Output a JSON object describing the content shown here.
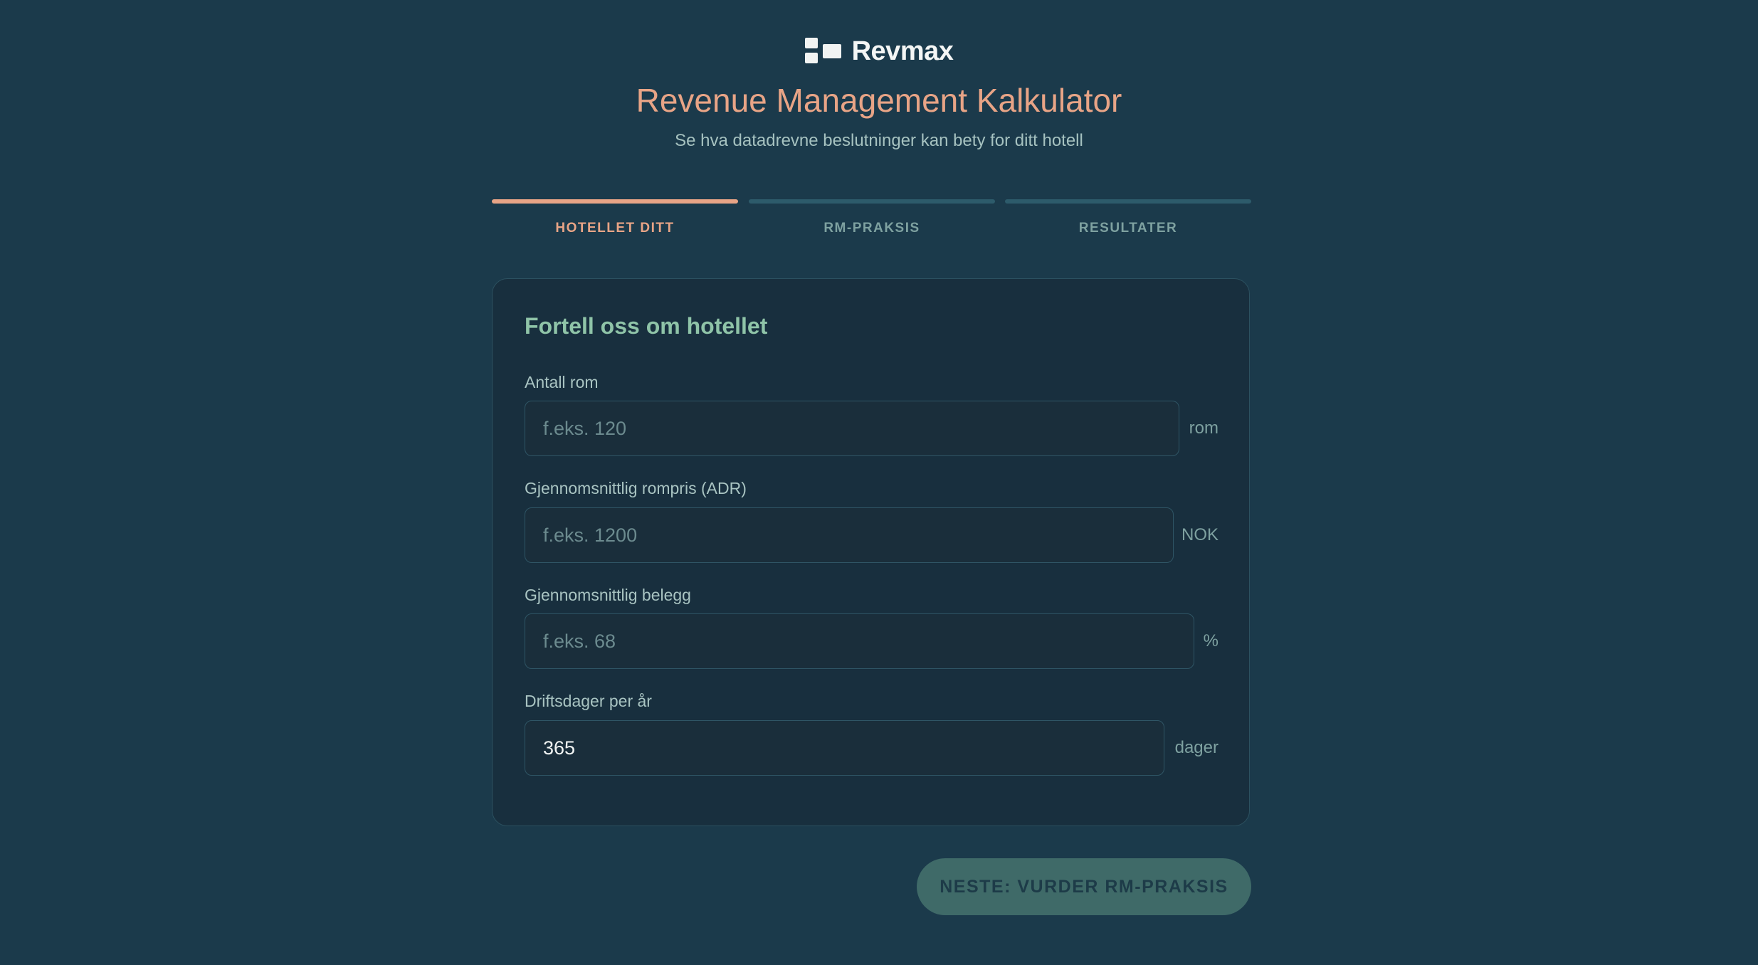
{
  "brand": {
    "name": "Revmax"
  },
  "header": {
    "title": "Revenue Management Kalkulator",
    "subtitle": "Se hva datadrevne beslutninger kan bety for ditt hotell"
  },
  "steps": [
    {
      "label": "HOTELLET DITT",
      "active": true
    },
    {
      "label": "RM-PRAKSIS",
      "active": false
    },
    {
      "label": "RESULTATER",
      "active": false
    }
  ],
  "form": {
    "title": "Fortell oss om hotellet",
    "fields": [
      {
        "label": "Antall rom",
        "placeholder": "f.eks. 120",
        "value": "",
        "unit": "rom"
      },
      {
        "label": "Gjennomsnittlig rompris (ADR)",
        "placeholder": "f.eks. 1200",
        "value": "",
        "unit": "NOK"
      },
      {
        "label": "Gjennomsnittlig belegg",
        "placeholder": "f.eks. 68",
        "value": "",
        "unit": "%"
      },
      {
        "label": "Driftsdager per år",
        "placeholder": "",
        "value": "365",
        "unit": "dager"
      }
    ]
  },
  "actions": {
    "next_label": "NESTE: VURDER RM-PRAKSIS"
  },
  "colors": {
    "background": "#1b3a4b",
    "accent": "#e8a486",
    "card_title": "#8fc4a8",
    "button_bg": "#3f6a68"
  }
}
